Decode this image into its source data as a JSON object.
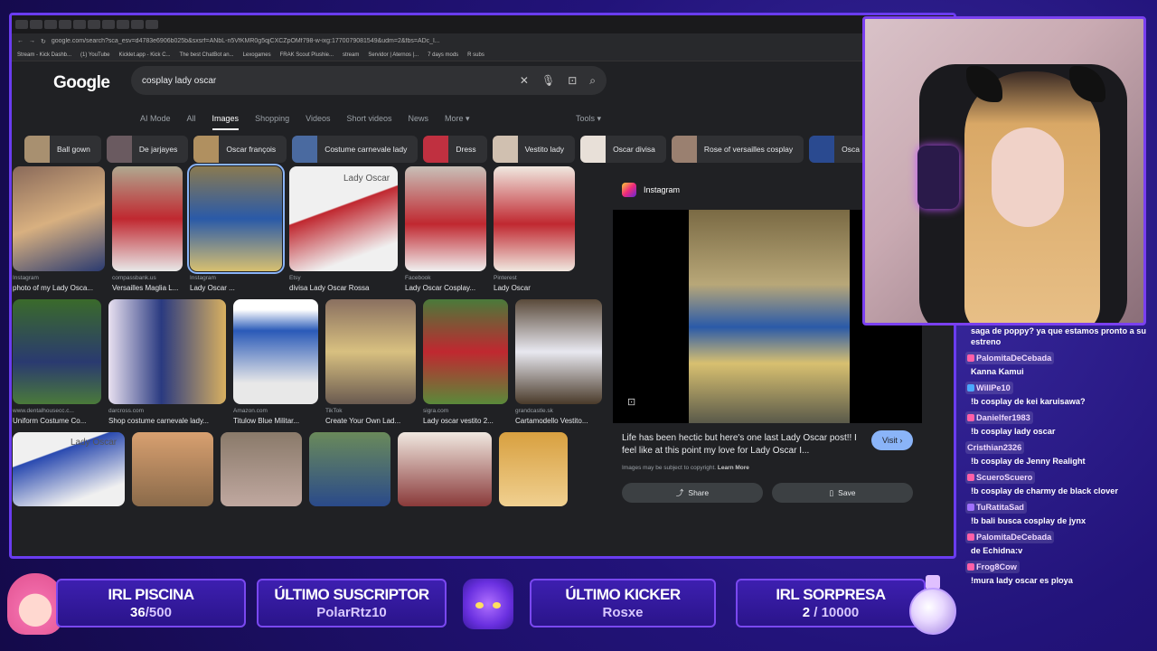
{
  "browser": {
    "url": "google.com/search?sca_esv=d4783e6906b025b&sxsrf=ANbL-n5VfKMR0g5qjCXCZpOMf798-w-ixg:1770079081549&udm=2&fbs=ADc_l...",
    "bookmarks": [
      "Stream - Kick Dashb...",
      "(1) YouTube",
      "Kicklet.app - Kick C...",
      "The best ChatBot an...",
      "Lexogames",
      "FRAK Scout Plushie...",
      "stream",
      "Servidor | Aternos |...",
      "7 days mods",
      "R subs"
    ]
  },
  "google": {
    "logo": "Google",
    "query": "cosplay lady oscar",
    "tabs": [
      "AI Mode",
      "All",
      "Images",
      "Shopping",
      "Videos",
      "Short videos",
      "News",
      "More ▾"
    ],
    "tools": "Tools ▾",
    "chips": [
      "Ball gown",
      "De jarjayes",
      "Oscar françois",
      "Costume carnevale lady",
      "Dress",
      "Vestito lady",
      "Oscar divisa",
      "Rose of versailles cosplay",
      "Osca"
    ],
    "results_row1": [
      {
        "src": "Instagram",
        "title": "photo of my Lady Osca..."
      },
      {
        "src": "compassbank.us",
        "title": "Versailles Maglia L..."
      },
      {
        "src": "Instagram",
        "title": "Lady Oscar ..."
      },
      {
        "src": "Etsy",
        "title": "divisa Lady Oscar Rossa"
      },
      {
        "src": "Facebook",
        "title": "Lady Oscar Cosplay..."
      },
      {
        "src": "Pinterest",
        "title": "Lady Oscar"
      }
    ],
    "results_row2": [
      {
        "src": "www.dentalhousecc.c...",
        "title": "Uniform Costume Co..."
      },
      {
        "src": "darcross.com",
        "title": "Shop costume carnevale lady..."
      },
      {
        "src": "Amazon.com",
        "title": "Titulow Blue Militar..."
      },
      {
        "src": "TikTok",
        "title": "Create Your Own Lad..."
      },
      {
        "src": "sigra.com",
        "title": "Lady oscar vestito 2..."
      },
      {
        "src": "grandcastle.sk",
        "title": "Cartamodello Vestito..."
      }
    ],
    "thumb_text": "Lady Oscar"
  },
  "preview": {
    "source": "Instagram",
    "description": "Life has been hectic but here's one last Lady Oscar post!! I feel like at this point my love for Lady Oscar I...",
    "visit": "Visit ›",
    "copyright": "Images may be subject to copyright.",
    "learn_more": "Learn More",
    "share": "Share",
    "save": "Save"
  },
  "chat": [
    {
      "user": "",
      "text": "saga de poppy? ya que estamos pronto a su estreno",
      "badge": ""
    },
    {
      "user": "PalomitaDeCebada",
      "text": "Kanna Kamui",
      "badge": "#ff5fa8"
    },
    {
      "user": "WillPe10",
      "text": "!b cosplay de kei karuisawa?",
      "badge": "#4aa8ff"
    },
    {
      "user": "Danielfer1983",
      "text": "!b cosplay lady oscar",
      "badge": "#ff5fa8"
    },
    {
      "user": "Cristhian2326",
      "text": "!b cosplay de Jenny Realight",
      "badge": ""
    },
    {
      "user": "ScueroScuero",
      "text": "!b cosplay de charmy de black clover",
      "badge": "#ff5fa8"
    },
    {
      "user": "TuRatitaSad",
      "text": "!b bali busca cosplay de jynx",
      "badge": "#a070ff"
    },
    {
      "user": "PalomitaDeCebada",
      "text": "de Echidna:v",
      "badge": "#ff5fa8"
    },
    {
      "user": "Frog8Cow",
      "text": "!mura lady oscar es ploya",
      "badge": "#ff5fa8"
    }
  ],
  "widgets": {
    "irl_piscina": {
      "label": "IRL PISCINA",
      "current": "36",
      "goal": "/500"
    },
    "ultimo_suscriptor": {
      "label": "ÚLTIMO SUSCRIPTOR",
      "value": "PolarRtz10"
    },
    "ultimo_kicker": {
      "label": "ÚLTIMO KICKER",
      "value": "Rosxe"
    },
    "irl_sorpresa": {
      "label": "IRL SORPRESA",
      "current": "2",
      "goal": " / 10000"
    }
  },
  "colors": {
    "accent": "#7a48f0",
    "link": "#8ab4f8"
  }
}
